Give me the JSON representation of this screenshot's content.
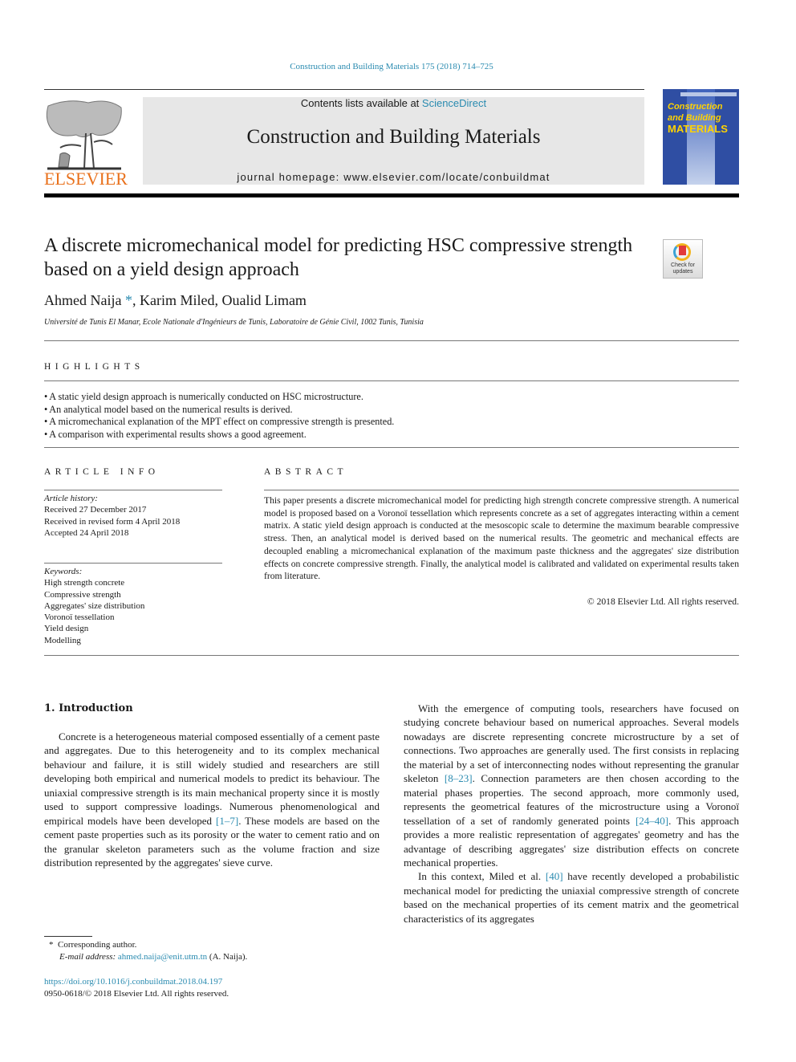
{
  "journal_reference": "Construction and Building Materials 175 (2018) 714–725",
  "header": {
    "publisher_logo": "elsevier-tree-logo",
    "publisher_name": "ELSEVIER",
    "contents_prefix": "Contents lists available at ",
    "contents_link": "ScienceDirect",
    "journal_title": "Construction and Building Materials",
    "homepage_label": "journal homepage: ",
    "homepage_url": "www.elsevier.com/locate/conbuildmat",
    "cover": {
      "line1": "Construction",
      "line2": "and Building",
      "line3": "MATERIALS"
    }
  },
  "article": {
    "title": "A discrete micromechanical model for predicting HSC compressive strength based on a yield design approach",
    "check_updates_line1": "Check for",
    "check_updates_line2": "updates",
    "authors": [
      {
        "name": "Ahmed Naija",
        "mark": "*"
      },
      {
        "name": "Karim Miled"
      },
      {
        "name": "Oualid Limam"
      }
    ],
    "author_sep": ", ",
    "affiliation": "Université de Tunis El Manar, Ecole Nationale d'Ingénieurs de Tunis, Laboratoire de Génie Civil, 1002 Tunis, Tunisia"
  },
  "highlights": {
    "label": "HIGHLIGHTS",
    "items": [
      "A static yield design approach is numerically conducted on HSC microstructure.",
      "An analytical model based on the numerical results is derived.",
      "A micromechanical explanation of the MPT effect on compressive strength is presented.",
      "A comparison with experimental results shows a good agreement."
    ]
  },
  "article_info": {
    "label": "ARTICLE INFO",
    "history_label": "Article history:",
    "history": [
      "Received 27 December 2017",
      "Received in revised form 4 April 2018",
      "Accepted 24 April 2018"
    ],
    "keywords_label": "Keywords:",
    "keywords": [
      "High strength concrete",
      "Compressive strength",
      "Aggregates' size distribution",
      "Voronoï tessellation",
      "Yield design",
      "Modelling"
    ]
  },
  "abstract": {
    "label": "ABSTRACT",
    "text": "This paper presents a discrete micromechanical model for predicting high strength concrete compressive strength. A numerical model is proposed based on a Voronoï tessellation which represents concrete as a set of aggregates interacting within a cement matrix. A static yield design approach is conducted at the mesoscopic scale to determine the maximum bearable compressive stress. Then, an analytical model is derived based on the numerical results. The geometric and mechanical effects are decoupled enabling a micromechanical explanation of the maximum paste thickness and the aggregates' size distribution effects on concrete compressive strength. Finally, the analytical model is calibrated and validated on experimental results taken from literature.",
    "copyright": "© 2018 Elsevier Ltd. All rights reserved."
  },
  "body": {
    "section_title": "1. Introduction",
    "left_p1_a": "Concrete is a heterogeneous material composed essentially of a cement paste and aggregates. Due to this heterogeneity and to its complex mechanical behaviour and failure, it is still widely studied and researchers are still developing both empirical and numerical models to predict its behaviour. The uniaxial compressive strength is its main mechanical property since it is mostly used to support compressive loadings. Numerous phenomenological and empirical models have been developed ",
    "left_p1_ref": "[1–7]",
    "left_p1_b": ". These models are based on the cement paste properties such as its porosity or the water to cement ratio and on the granular skeleton parameters such as the volume fraction and size distribution represented by the aggregates' sieve curve.",
    "right_p1_a": "With the emergence of computing tools, researchers have focused on studying concrete behaviour based on numerical approaches. Several models nowadays are discrete representing concrete microstructure by a set of connections. Two approaches are generally used. The first consists in replacing the material by a set of interconnecting nodes without representing the granular skeleton ",
    "right_p1_ref1": "[8–23]",
    "right_p1_b": ". Connection parameters are then chosen according to the material phases properties. The second approach, more commonly used, represents the geometrical features of the microstructure using a Voronoï tessellation of a set of randomly generated points ",
    "right_p1_ref2": "[24–40]",
    "right_p1_c": ". This approach provides a more realistic representation of aggregates' geometry and has the advantage of describing aggregates' size distribution effects on concrete mechanical properties.",
    "right_p2_a": "In this context, Miled et al. ",
    "right_p2_ref": "[40]",
    "right_p2_b": " have recently developed a probabilistic mechanical model for predicting the uniaxial compressive strength of concrete based on the mechanical properties of its cement matrix and the geometrical characteristics of its aggregates"
  },
  "footnotes": {
    "mark": "*",
    "corresponding": "Corresponding author.",
    "email_label": "E-mail address: ",
    "email": "ahmed.naija@enit.utm.tn",
    "email_suffix": " (A. Naija).",
    "doi": "https://doi.org/10.1016/j.conbuildmat.2018.04.197",
    "issn_line": "0950-0618/© 2018 Elsevier Ltd. All rights reserved."
  },
  "colors": {
    "link": "#2a8bb0",
    "elsevier_orange": "#e9711c",
    "cover_blue": "#2f4ea3",
    "cover_yellow": "#ffd200",
    "header_gray": "#e7e7e7"
  }
}
